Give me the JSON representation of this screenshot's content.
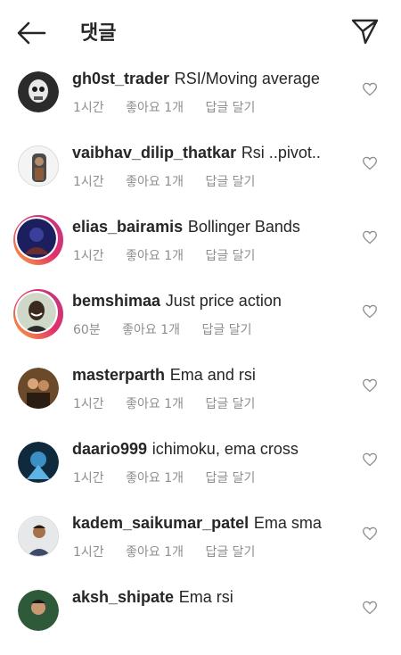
{
  "header": {
    "title": "댓글",
    "back_icon": "arrow-left-icon",
    "send_icon": "paper-plane-icon"
  },
  "comments": [
    {
      "username": "gh0st_trader",
      "text": "RSI/Moving average",
      "time": "1시간",
      "likes": "좋아요 1개",
      "reply": "답글 달기",
      "story_ring": false
    },
    {
      "username": "vaibhav_dilip_thatkar",
      "text": "Rsi ..pivot..",
      "time": "1시간",
      "likes": "좋아요 1개",
      "reply": "답글 달기",
      "story_ring": false
    },
    {
      "username": "elias_bairamis",
      "text": "Bollinger Bands",
      "time": "1시간",
      "likes": "좋아요 1개",
      "reply": "답글 달기",
      "story_ring": true
    },
    {
      "username": "bemshimaa",
      "text": "Just price action",
      "time": "60분",
      "likes": "좋아요 1개",
      "reply": "답글 달기",
      "story_ring": true
    },
    {
      "username": "masterparth",
      "text": "Ema and rsi",
      "time": "1시간",
      "likes": "좋아요 1개",
      "reply": "답글 달기",
      "story_ring": false
    },
    {
      "username": "daario999",
      "text": "ichimoku, ema cross",
      "time": "1시간",
      "likes": "좋아요 1개",
      "reply": "답글 달기",
      "story_ring": false
    },
    {
      "username": "kadem_saikumar_patel",
      "text": "Ema sma",
      "time": "1시간",
      "likes": "좋아요 1개",
      "reply": "답글 달기",
      "story_ring": false
    },
    {
      "username": "aksh_shipate",
      "text": "Ema rsi",
      "time": "",
      "likes": "",
      "reply": "",
      "story_ring": false
    }
  ],
  "colors": {
    "primary_text": "#262626",
    "secondary_text": "#8e8e8e",
    "story_ring_start": "#f9a93b",
    "story_ring_end": "#c13584"
  }
}
